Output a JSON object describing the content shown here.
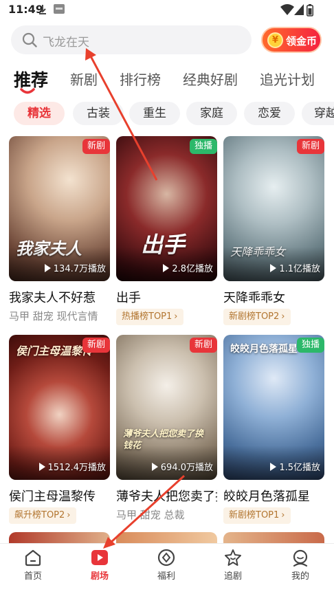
{
  "status_bar": {
    "time": "11:49",
    "icons": [
      "download-icon",
      "app-notification-icon",
      "wifi-icon",
      "signal-icon",
      "battery-icon"
    ]
  },
  "search": {
    "placeholder": "飞龙在天",
    "icon": "search-icon"
  },
  "coin_button": {
    "label": "领金币",
    "coin_symbol": "¥"
  },
  "tabs": [
    {
      "label": "推荐",
      "active": true
    },
    {
      "label": "新剧",
      "active": false
    },
    {
      "label": "排行榜",
      "active": false
    },
    {
      "label": "经典好剧",
      "active": false
    },
    {
      "label": "追光计划",
      "active": false
    }
  ],
  "chips": [
    {
      "label": "精选",
      "active": true
    },
    {
      "label": "古装",
      "active": false
    },
    {
      "label": "重生",
      "active": false
    },
    {
      "label": "家庭",
      "active": false
    },
    {
      "label": "恋爱",
      "active": false
    },
    {
      "label": "穿越",
      "active": false
    }
  ],
  "cards": [
    {
      "title": "我家夫人不好惹",
      "poster_text": "我家夫人",
      "badge": "新剧",
      "badge_color": "#e8353a",
      "plays": "134.7万播放",
      "tags": "马甲 甜宠 现代言情",
      "rank": ""
    },
    {
      "title": "出手",
      "poster_text": "出手",
      "badge": "独播",
      "badge_color": "#2cb86a",
      "plays": "2.8亿播放",
      "tags": "",
      "rank": "热播榜TOP1"
    },
    {
      "title": "天降乖乖女",
      "poster_text": "天降乖乖女",
      "badge": "新剧",
      "badge_color": "#e8353a",
      "plays": "1.1亿播放",
      "tags": "",
      "rank": "新剧榜TOP2"
    },
    {
      "title": "侯门主母温黎传",
      "poster_text": "侯门主母温黎传",
      "badge": "新剧",
      "badge_color": "#e8353a",
      "plays": "1512.4万播放",
      "tags": "",
      "rank": "飙升榜TOP2"
    },
    {
      "title": "薄爷夫人把您卖了换钱花",
      "poster_text": "薄爷夫人把您卖了换钱花",
      "badge": "新剧",
      "badge_color": "#e8353a",
      "plays": "694.0万播放",
      "tags": "马甲 甜宠 总裁",
      "rank": ""
    },
    {
      "title": "皎皎月色落孤星",
      "poster_text": "皎皎月色落孤星",
      "badge": "独播",
      "badge_color": "#2cb86a",
      "plays": "1.5亿播放",
      "tags": "",
      "rank": "新剧榜TOP1"
    }
  ],
  "bottom_nav": [
    {
      "label": "首页",
      "icon": "home-icon",
      "active": false
    },
    {
      "label": "剧场",
      "icon": "play-icon",
      "active": true
    },
    {
      "label": "福利",
      "icon": "gift-icon",
      "active": false
    },
    {
      "label": "追剧",
      "icon": "star-icon",
      "active": false
    },
    {
      "label": "我的",
      "icon": "profile-icon",
      "active": false
    }
  ],
  "colors": {
    "accent": "#e8353a",
    "green_badge": "#2cb86a",
    "rank_bg": "#fbf2e6",
    "rank_text": "#b27530",
    "annotation_arrow": "#e8402d"
  }
}
